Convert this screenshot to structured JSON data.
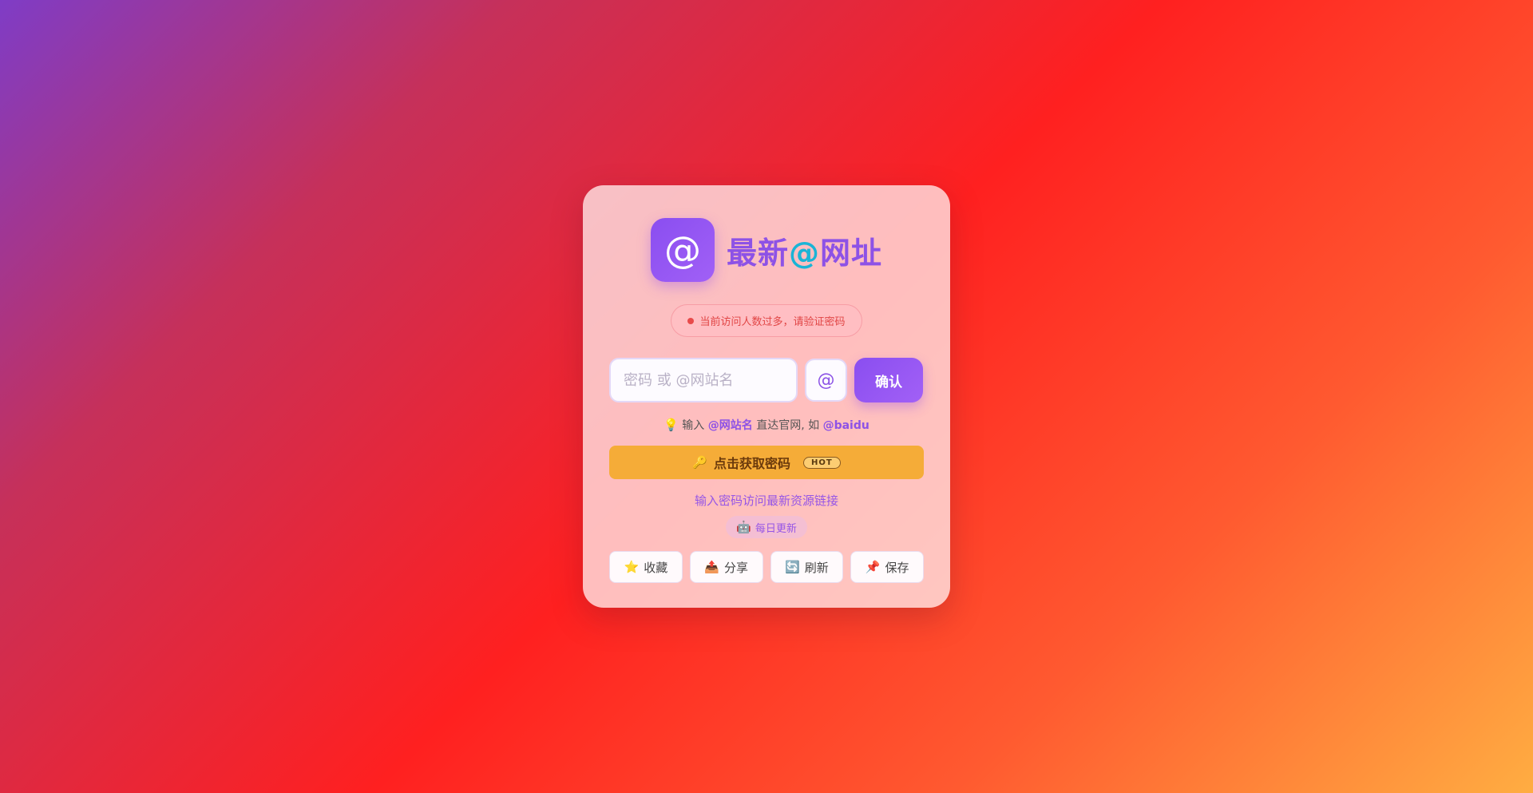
{
  "brand": {
    "logo_symbol": "@",
    "title_prefix": "最新",
    "title_at": "@",
    "title_suffix": "网址",
    "accent_color": "#8d52e6",
    "at_color": "#1ab4d6"
  },
  "alert": {
    "text": "当前访问人数过多，请验证密码",
    "dot_color": "#e84a4a"
  },
  "form": {
    "placeholder": "密码 或 @网站名",
    "value": "",
    "at_button": "@",
    "confirm_label": "确认"
  },
  "hint": {
    "icon": "lightbulb-icon",
    "glyph": "💡",
    "before": "输入",
    "highlight1": "@网站名",
    "middle": "直达官网, 如",
    "highlight2": "@baidu"
  },
  "get_password": {
    "icon": "key-icon",
    "glyph": "🔑",
    "label": "点击获取密码",
    "badge": "HOT",
    "color": "#f5ac38"
  },
  "description_link": "输入密码访问最新资源链接",
  "daily": {
    "icon": "robot-icon",
    "glyph": "🤖",
    "label": "每日更新"
  },
  "actions": [
    {
      "icon": "star-icon",
      "glyph": "⭐",
      "label": "收藏"
    },
    {
      "icon": "share-icon",
      "glyph": "📤",
      "label": "分享"
    },
    {
      "icon": "refresh-icon",
      "glyph": "🔄",
      "label": "刷新"
    },
    {
      "icon": "pin-icon",
      "glyph": "📌",
      "label": "保存"
    }
  ]
}
